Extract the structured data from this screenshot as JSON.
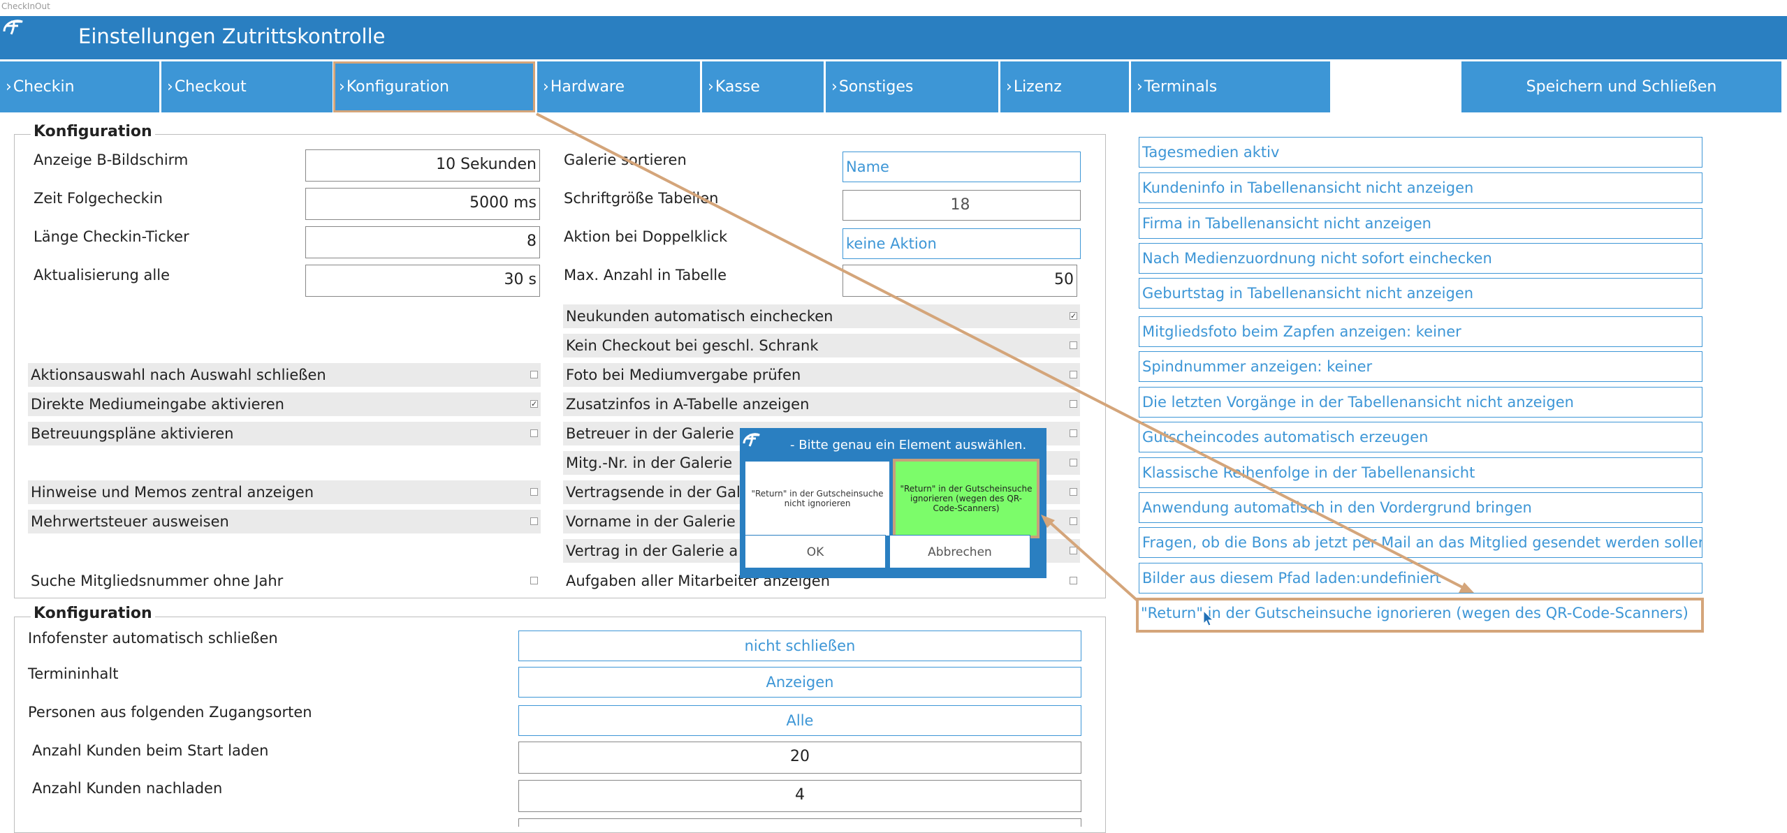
{
  "window": {
    "title": "CheckInOut"
  },
  "header": {
    "title": "Einstellungen Zutrittskontrolle"
  },
  "tabs": [
    "Checkin",
    "Checkout",
    "Konfiguration",
    "Hardware",
    "Kasse",
    "Sonstiges",
    "Lizenz",
    "Terminals"
  ],
  "tab_chevron": "›",
  "save_button": "Speichern und Schließen",
  "group1": {
    "title": "Konfiguration",
    "fields_left": [
      {
        "label": "Anzeige B-Bildschirm",
        "value": "10 Sekunden"
      },
      {
        "label": "Zeit Folgecheckin",
        "value": "5000 ms"
      },
      {
        "label": "Länge Checkin-Ticker",
        "value": "8"
      },
      {
        "label": "Aktualisierung alle",
        "value": "30 s"
      }
    ],
    "fields_right": [
      {
        "label": "Galerie sortieren",
        "value": "Name"
      },
      {
        "label": "Schriftgröße Tabellen",
        "value": "18"
      },
      {
        "label": "Aktion bei Doppelklick",
        "value": "keine Aktion"
      },
      {
        "label": "Max. Anzahl in Tabelle",
        "value": "50"
      }
    ],
    "checks_left": [
      {
        "label": "Aktionsauswahl nach Auswahl schließen",
        "checked": false
      },
      {
        "label": "Direkte Mediumeingabe aktivieren",
        "checked": true
      },
      {
        "label": "Betreuungspläne aktivieren",
        "checked": false
      },
      {
        "label": "Hinweise und Memos zentral anzeigen",
        "checked": false
      },
      {
        "label": "Mehrwertsteuer ausweisen",
        "checked": false
      },
      {
        "label": "Suche Mitgliedsnummer ohne Jahr",
        "checked": false
      }
    ],
    "checks_right": [
      {
        "label": "Neukunden automatisch einchecken",
        "checked": true
      },
      {
        "label": "Kein Checkout bei geschl. Schrank",
        "checked": false
      },
      {
        "label": "Foto bei Mediumvergabe prüfen",
        "checked": false
      },
      {
        "label": "Zusatzinfos in A-Tabelle anzeigen",
        "checked": false
      },
      {
        "label": "Betreuer in der Galerie",
        "checked": false
      },
      {
        "label": "Mitg.-Nr. in der Galerie",
        "checked": false
      },
      {
        "label": "Vertragsende in der Gal",
        "checked": false
      },
      {
        "label": "Vorname in der Galerie",
        "checked": false
      },
      {
        "label": "Vertrag in der Galerie a",
        "checked": false
      },
      {
        "label": "Aufgaben aller Mitarbeiter anzeigen",
        "checked": false
      }
    ],
    "check_mark": "✓"
  },
  "group2": {
    "title": "Konfiguration",
    "fields": [
      {
        "label": "Infofenster automatisch schließen",
        "value": "nicht schließen"
      },
      {
        "label": "Termininhalt",
        "value": "Anzeigen"
      },
      {
        "label": "Personen aus folgenden Zugangsorten",
        "value": "Alle"
      },
      {
        "label": "Anzahl Kunden beim Start laden",
        "value": "20"
      },
      {
        "label": "Anzahl Kunden nachladen",
        "value": "4"
      }
    ]
  },
  "right_panel": [
    "Tagesmedien aktiv",
    "Kundeninfo in Tabellenansicht nicht anzeigen",
    "Firma in Tabellenansicht nicht anzeigen",
    "Nach Medienzuordnung nicht sofort einchecken",
    "Geburtstag in Tabellenansicht nicht anzeigen",
    "Mitgliedsfoto beim Zapfen anzeigen: keiner",
    "Spindnummer anzeigen: keiner",
    "Die letzten Vorgänge in der Tabellenansicht nicht anzeigen",
    "Gutscheincodes automatisch erzeugen",
    "Klassische Reihenfolge in der Tabellenansicht",
    "Anwendung automatisch in den Vordergrund bringen",
    "Fragen, ob die Bons ab jetzt per Mail an das Mitglied gesendet werden sollen",
    "Bilder aus diesem Pfad laden:undefiniert",
    "\"Return\" in der Gutscheinsuche ignorieren (wegen des QR-Code-Scanners)"
  ],
  "dialog": {
    "title": "- Bitte genau ein Element auswählen.",
    "option1": "\"Return\" in der Gutscheinsuche nicht ignorieren",
    "option2": "\"Return\" in der Gutscheinsuche ignorieren (wegen des QR-Code-Scanners)",
    "ok": "OK",
    "cancel": "Abbrechen"
  },
  "colors": {
    "header": "#2a7fc1",
    "tab": "#3d96d6",
    "accent_text": "#3d96d6",
    "highlight": "#d4a57a",
    "selected_option": "#7cfc6a"
  },
  "icons": [
    "app-logo-icon",
    "chevron-right-icon",
    "mouse-cursor-icon"
  ]
}
